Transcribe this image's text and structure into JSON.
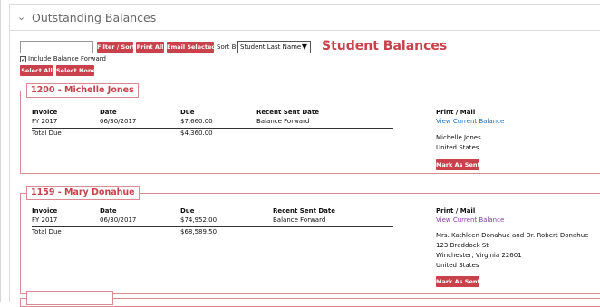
{
  "panel": {
    "title": "Outstanding Balances"
  },
  "toolbar": {
    "search_value": "",
    "filter_sort": "Filter / Sort",
    "print_all": "Print All",
    "email_selected": "Email Selected",
    "sort_by_label": "Sort By",
    "sort_by_value": "Student Last Name",
    "heading": "Student Balances",
    "include_balance_forward": "Include Balance Forward",
    "include_balance_forward_checked": true,
    "select_all": "Select All",
    "select_none": "Select None"
  },
  "columns": {
    "invoice": "Invoice",
    "date": "Date",
    "due": "Due",
    "recent_sent_date": "Recent Sent Date",
    "print_mail": "Print / Mail"
  },
  "students": [
    {
      "title": "1200 - Michelle Jones",
      "invoice": "FY 2017",
      "date": "06/30/2017",
      "due": "$7,660.00",
      "recent_sent": "Balance Forward",
      "total_label": "Total Due",
      "total": "$4,360.00",
      "view_link": "View Current Balance",
      "address": [
        "Michelle Jones",
        "United States"
      ],
      "mark_sent": "Mark As Sent"
    },
    {
      "title": "1159 - Mary Donahue",
      "invoice": "FY 2017",
      "date": "06/30/2017",
      "due": "$74,952.00",
      "recent_sent": "Balance Forward",
      "total_label": "Total Due",
      "total": "$68,589.50",
      "view_link": "View Current Balance",
      "address": [
        "Mrs. Kathleen Donahue and Dr. Robert Donahue",
        "123 Braddock St",
        "Winchester, Virginia 22601",
        "United States"
      ],
      "mark_sent": "Mark As Sent"
    }
  ],
  "colors": {
    "accent": "#c8414b",
    "link": "#1a6fc4",
    "visited_link": "#8b3aa8"
  }
}
